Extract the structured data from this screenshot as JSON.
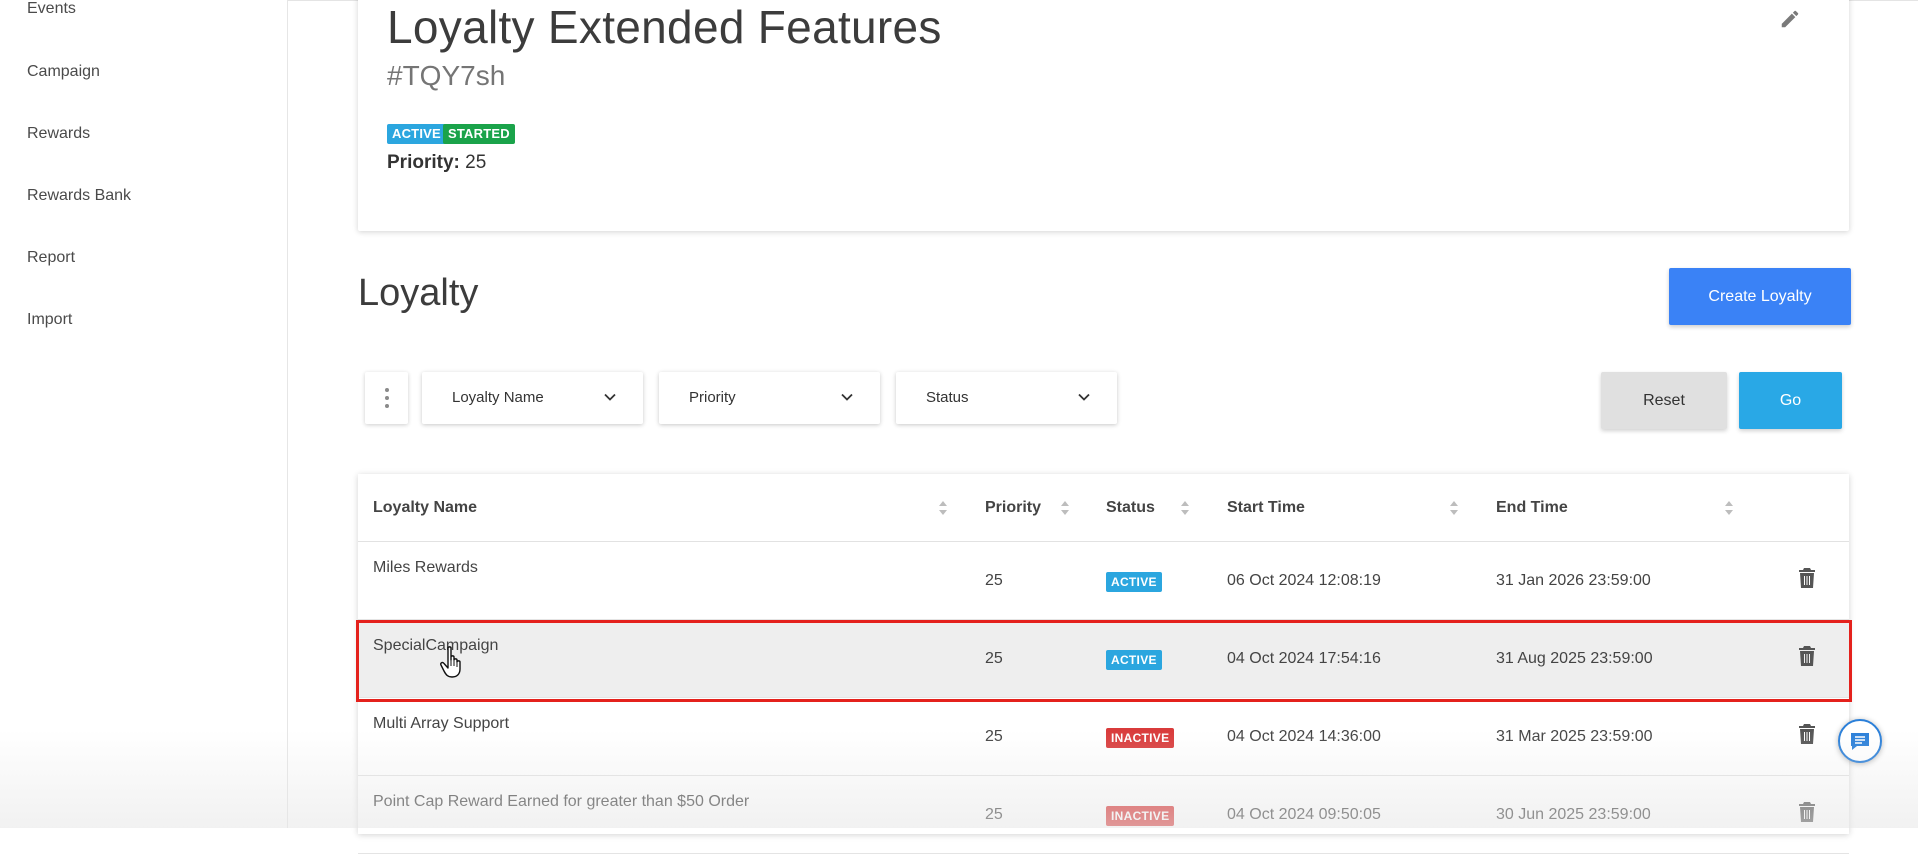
{
  "sidebar": {
    "items": [
      {
        "label": "Events"
      },
      {
        "label": "Campaign"
      },
      {
        "label": "Rewards"
      },
      {
        "label": "Rewards Bank"
      },
      {
        "label": "Report"
      },
      {
        "label": "Import"
      }
    ]
  },
  "detail": {
    "title": "Loyalty Extended Features",
    "code": "#TQY7sh",
    "badges": {
      "active": "ACTIVE",
      "started": "STARTED"
    },
    "priority_label": "Priority:",
    "priority_value": "25",
    "edit_icon": "pencil-icon"
  },
  "section": {
    "title": "Loyalty",
    "create_button": "Create Loyalty"
  },
  "filters": {
    "more_icon": "vertical-dots-icon",
    "loyalty_name": "Loyalty Name",
    "priority": "Priority",
    "status": "Status",
    "reset": "Reset",
    "go": "Go"
  },
  "table": {
    "headers": {
      "name": "Loyalty Name",
      "priority": "Priority",
      "status": "Status",
      "start": "Start Time",
      "end": "End Time"
    },
    "rows": [
      {
        "name": "Miles Rewards",
        "priority": "25",
        "status": "ACTIVE",
        "start": "06 Oct 2024 12:08:19",
        "end": "31 Jan 2026 23:59:00"
      },
      {
        "name": "SpecialCampaign",
        "priority": "25",
        "status": "ACTIVE",
        "start": "04 Oct 2024 17:54:16",
        "end": "31 Aug 2025 23:59:00"
      },
      {
        "name": "Multi Array Support",
        "priority": "25",
        "status": "INACTIVE",
        "start": "04 Oct 2024 14:36:00",
        "end": "31 Mar 2025 23:59:00"
      },
      {
        "name": "Point Cap Reward Earned for greater than $50 Order",
        "priority": "25",
        "status": "INACTIVE",
        "start": "04 Oct 2024 09:50:05",
        "end": "30 Jun 2025 23:59:00"
      }
    ]
  },
  "colors": {
    "primary": "#3a82f6",
    "go": "#29a8e6",
    "active": "#2ba6df",
    "started": "#1aa34a",
    "inactive": "#d93b3b",
    "highlight": "#e4211c"
  }
}
